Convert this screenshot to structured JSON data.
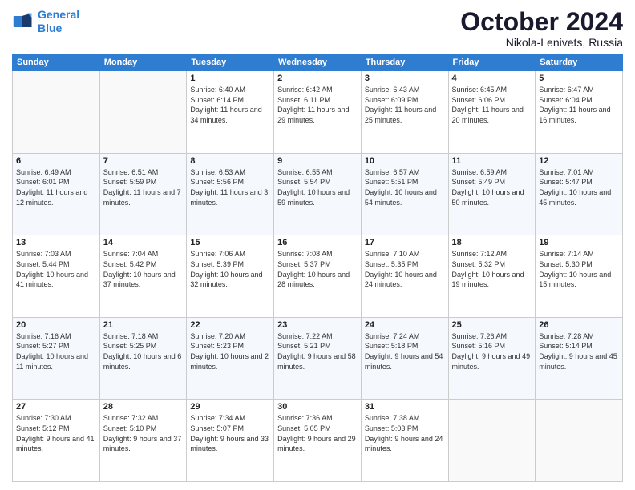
{
  "logo": {
    "line1": "General",
    "line2": "Blue"
  },
  "title": "October 2024",
  "location": "Nikola-Lenivets, Russia",
  "weekdays": [
    "Sunday",
    "Monday",
    "Tuesday",
    "Wednesday",
    "Thursday",
    "Friday",
    "Saturday"
  ],
  "weeks": [
    [
      {
        "day": "",
        "sunrise": "",
        "sunset": "",
        "daylight": ""
      },
      {
        "day": "",
        "sunrise": "",
        "sunset": "",
        "daylight": ""
      },
      {
        "day": "1",
        "sunrise": "Sunrise: 6:40 AM",
        "sunset": "Sunset: 6:14 PM",
        "daylight": "Daylight: 11 hours and 34 minutes."
      },
      {
        "day": "2",
        "sunrise": "Sunrise: 6:42 AM",
        "sunset": "Sunset: 6:11 PM",
        "daylight": "Daylight: 11 hours and 29 minutes."
      },
      {
        "day": "3",
        "sunrise": "Sunrise: 6:43 AM",
        "sunset": "Sunset: 6:09 PM",
        "daylight": "Daylight: 11 hours and 25 minutes."
      },
      {
        "day": "4",
        "sunrise": "Sunrise: 6:45 AM",
        "sunset": "Sunset: 6:06 PM",
        "daylight": "Daylight: 11 hours and 20 minutes."
      },
      {
        "day": "5",
        "sunrise": "Sunrise: 6:47 AM",
        "sunset": "Sunset: 6:04 PM",
        "daylight": "Daylight: 11 hours and 16 minutes."
      }
    ],
    [
      {
        "day": "6",
        "sunrise": "Sunrise: 6:49 AM",
        "sunset": "Sunset: 6:01 PM",
        "daylight": "Daylight: 11 hours and 12 minutes."
      },
      {
        "day": "7",
        "sunrise": "Sunrise: 6:51 AM",
        "sunset": "Sunset: 5:59 PM",
        "daylight": "Daylight: 11 hours and 7 minutes."
      },
      {
        "day": "8",
        "sunrise": "Sunrise: 6:53 AM",
        "sunset": "Sunset: 5:56 PM",
        "daylight": "Daylight: 11 hours and 3 minutes."
      },
      {
        "day": "9",
        "sunrise": "Sunrise: 6:55 AM",
        "sunset": "Sunset: 5:54 PM",
        "daylight": "Daylight: 10 hours and 59 minutes."
      },
      {
        "day": "10",
        "sunrise": "Sunrise: 6:57 AM",
        "sunset": "Sunset: 5:51 PM",
        "daylight": "Daylight: 10 hours and 54 minutes."
      },
      {
        "day": "11",
        "sunrise": "Sunrise: 6:59 AM",
        "sunset": "Sunset: 5:49 PM",
        "daylight": "Daylight: 10 hours and 50 minutes."
      },
      {
        "day": "12",
        "sunrise": "Sunrise: 7:01 AM",
        "sunset": "Sunset: 5:47 PM",
        "daylight": "Daylight: 10 hours and 45 minutes."
      }
    ],
    [
      {
        "day": "13",
        "sunrise": "Sunrise: 7:03 AM",
        "sunset": "Sunset: 5:44 PM",
        "daylight": "Daylight: 10 hours and 41 minutes."
      },
      {
        "day": "14",
        "sunrise": "Sunrise: 7:04 AM",
        "sunset": "Sunset: 5:42 PM",
        "daylight": "Daylight: 10 hours and 37 minutes."
      },
      {
        "day": "15",
        "sunrise": "Sunrise: 7:06 AM",
        "sunset": "Sunset: 5:39 PM",
        "daylight": "Daylight: 10 hours and 32 minutes."
      },
      {
        "day": "16",
        "sunrise": "Sunrise: 7:08 AM",
        "sunset": "Sunset: 5:37 PM",
        "daylight": "Daylight: 10 hours and 28 minutes."
      },
      {
        "day": "17",
        "sunrise": "Sunrise: 7:10 AM",
        "sunset": "Sunset: 5:35 PM",
        "daylight": "Daylight: 10 hours and 24 minutes."
      },
      {
        "day": "18",
        "sunrise": "Sunrise: 7:12 AM",
        "sunset": "Sunset: 5:32 PM",
        "daylight": "Daylight: 10 hours and 19 minutes."
      },
      {
        "day": "19",
        "sunrise": "Sunrise: 7:14 AM",
        "sunset": "Sunset: 5:30 PM",
        "daylight": "Daylight: 10 hours and 15 minutes."
      }
    ],
    [
      {
        "day": "20",
        "sunrise": "Sunrise: 7:16 AM",
        "sunset": "Sunset: 5:27 PM",
        "daylight": "Daylight: 10 hours and 11 minutes."
      },
      {
        "day": "21",
        "sunrise": "Sunrise: 7:18 AM",
        "sunset": "Sunset: 5:25 PM",
        "daylight": "Daylight: 10 hours and 6 minutes."
      },
      {
        "day": "22",
        "sunrise": "Sunrise: 7:20 AM",
        "sunset": "Sunset: 5:23 PM",
        "daylight": "Daylight: 10 hours and 2 minutes."
      },
      {
        "day": "23",
        "sunrise": "Sunrise: 7:22 AM",
        "sunset": "Sunset: 5:21 PM",
        "daylight": "Daylight: 9 hours and 58 minutes."
      },
      {
        "day": "24",
        "sunrise": "Sunrise: 7:24 AM",
        "sunset": "Sunset: 5:18 PM",
        "daylight": "Daylight: 9 hours and 54 minutes."
      },
      {
        "day": "25",
        "sunrise": "Sunrise: 7:26 AM",
        "sunset": "Sunset: 5:16 PM",
        "daylight": "Daylight: 9 hours and 49 minutes."
      },
      {
        "day": "26",
        "sunrise": "Sunrise: 7:28 AM",
        "sunset": "Sunset: 5:14 PM",
        "daylight": "Daylight: 9 hours and 45 minutes."
      }
    ],
    [
      {
        "day": "27",
        "sunrise": "Sunrise: 7:30 AM",
        "sunset": "Sunset: 5:12 PM",
        "daylight": "Daylight: 9 hours and 41 minutes."
      },
      {
        "day": "28",
        "sunrise": "Sunrise: 7:32 AM",
        "sunset": "Sunset: 5:10 PM",
        "daylight": "Daylight: 9 hours and 37 minutes."
      },
      {
        "day": "29",
        "sunrise": "Sunrise: 7:34 AM",
        "sunset": "Sunset: 5:07 PM",
        "daylight": "Daylight: 9 hours and 33 minutes."
      },
      {
        "day": "30",
        "sunrise": "Sunrise: 7:36 AM",
        "sunset": "Sunset: 5:05 PM",
        "daylight": "Daylight: 9 hours and 29 minutes."
      },
      {
        "day": "31",
        "sunrise": "Sunrise: 7:38 AM",
        "sunset": "Sunset: 5:03 PM",
        "daylight": "Daylight: 9 hours and 24 minutes."
      },
      {
        "day": "",
        "sunrise": "",
        "sunset": "",
        "daylight": ""
      },
      {
        "day": "",
        "sunrise": "",
        "sunset": "",
        "daylight": ""
      }
    ]
  ]
}
